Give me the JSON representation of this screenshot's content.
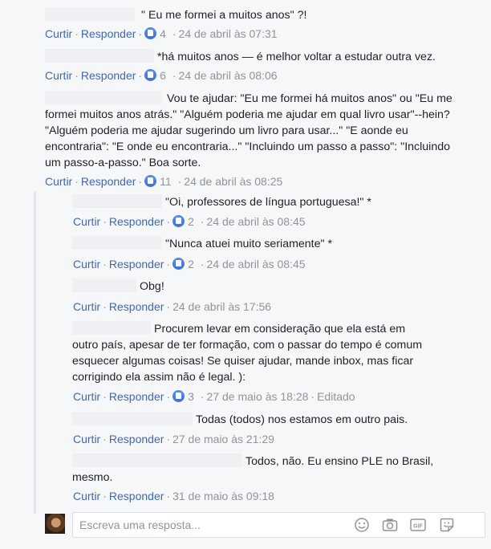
{
  "actions": {
    "like": "Curtir",
    "reply": "Responder",
    "separator": "·"
  },
  "comments": [
    {
      "text": "\" Eu me formei a muitos anos\" ?!",
      "likes": "4",
      "time": "24 de abril às 07:31"
    },
    {
      "text": "*há muitos anos — é melhor voltar a estudar outra vez.",
      "likes": "6",
      "time": "24 de abril às 08:06"
    },
    {
      "text": "Vou te ajudar: \"Eu me formei há muitos anos\" ou \"Eu me formei muitos anos atrás.\" \"Alguém poderia me ajudar em qual livro usar\"--hein? \"Alguém poderia me ajudar sugerindo um livro para usar...\" \"E aonde eu encontraria\": \"E onde eu encontraria...\" \"Incluindo um passo a passo\": \"Incluindo um passo-a-passo.\" Boa sorte.",
      "likes": "11",
      "time": "24 de abril às 08:25"
    }
  ],
  "replies": [
    {
      "text": "\"Oi, professores de língua portuguesa!\" *",
      "likes": "2",
      "time": "24 de abril às 08:45"
    },
    {
      "text": "\"Nunca atuei muito seriamente\" *",
      "likes": "2",
      "time": "24 de abril às 08:45"
    },
    {
      "text": "Obg!",
      "likes": "",
      "time": "24 de abril às 17:56"
    },
    {
      "text": "Procurem levar em consideração que ela está em outro país, apesar de ter formação, com o passar do tempo é comum esquecer algumas coisas! Se quiser ajudar, mande inbox, mas ficar corrigindo ela assim não é legal. ):",
      "likes": "3",
      "time": "27 de maio às 18:28",
      "edited": "Editado"
    },
    {
      "text": "Todas (todos) nos estamos em outro pais.",
      "likes": "",
      "time": "27 de maio às 21:29"
    },
    {
      "text": "Todos, não. Eu ensino PLE no Brasil, mesmo.",
      "likes": "",
      "time": "31 de maio às 09:18"
    }
  ],
  "reply_box": {
    "placeholder": "Escreva uma resposta...",
    "gif": "GIF"
  }
}
